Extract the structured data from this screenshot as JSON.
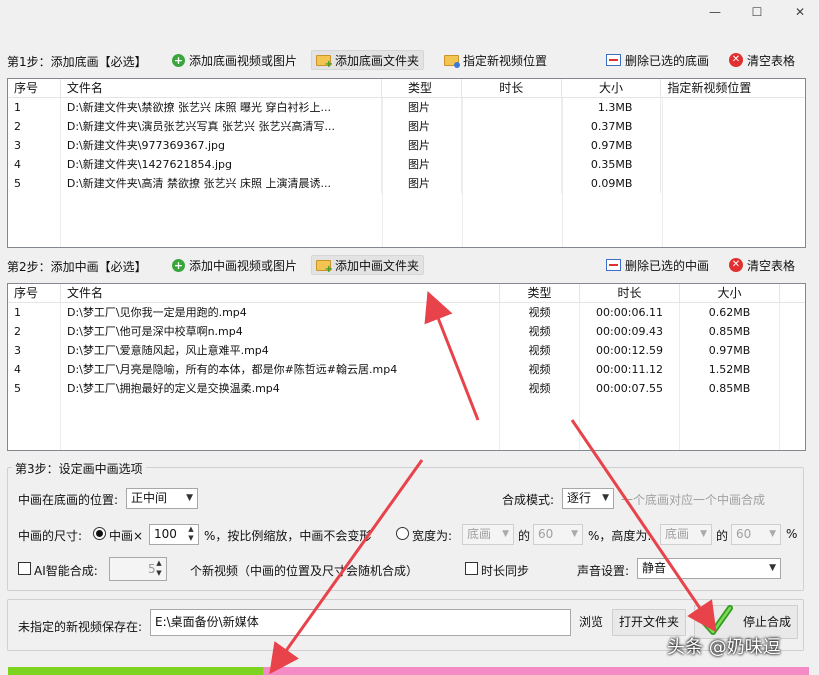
{
  "window": {
    "minimize": "—",
    "maximize": "☐",
    "close": "✕"
  },
  "step1": {
    "label": "第1步：添加底画【必选】",
    "toolbar": {
      "add_media": "添加底画视频或图片",
      "add_folder": "添加底画文件夹",
      "set_location": "指定新视频位置",
      "delete_selected": "删除已选的底画",
      "clear": "清空表格"
    },
    "columns": [
      "序号",
      "文件名",
      "类型",
      "时长",
      "大小",
      "指定新视频位置"
    ],
    "rows": [
      {
        "index": "1",
        "name": "D:\\新建文件夹\\禁欲撩 张艺兴 床照 曝光 穿白衬衫上...",
        "type": "图片",
        "duration": "",
        "size": "1.3MB",
        "location": ""
      },
      {
        "index": "2",
        "name": "D:\\新建文件夹\\演员张艺兴写真 张艺兴 张艺兴高清写...",
        "type": "图片",
        "duration": "",
        "size": "0.37MB",
        "location": ""
      },
      {
        "index": "3",
        "name": "D:\\新建文件夹\\977369367.jpg",
        "type": "图片",
        "duration": "",
        "size": "0.97MB",
        "location": ""
      },
      {
        "index": "4",
        "name": "D:\\新建文件夹\\1427621854.jpg",
        "type": "图片",
        "duration": "",
        "size": "0.35MB",
        "location": ""
      },
      {
        "index": "5",
        "name": "D:\\新建文件夹\\高清 禁欲撩 张艺兴 床照 上演清晨诱...",
        "type": "图片",
        "duration": "",
        "size": "0.09MB",
        "location": ""
      }
    ]
  },
  "step2": {
    "label": "第2步：添加中画【必选】",
    "toolbar": {
      "add_media": "添加中画视频或图片",
      "add_folder": "添加中画文件夹",
      "delete_selected": "删除已选的中画",
      "clear": "清空表格"
    },
    "columns": [
      "序号",
      "文件名",
      "类型",
      "时长",
      "大小"
    ],
    "rows": [
      {
        "index": "1",
        "name": "D:\\梦工厂\\见你我一定是用跑的.mp4",
        "type": "视频",
        "duration": "00:00:06.11",
        "size": "0.62MB"
      },
      {
        "index": "2",
        "name": "D:\\梦工厂\\他可是深中校草啊n.mp4",
        "type": "视频",
        "duration": "00:00:09.43",
        "size": "0.85MB"
      },
      {
        "index": "3",
        "name": "D:\\梦工厂\\爱意随风起，风止意难平.mp4",
        "type": "视频",
        "duration": "00:00:12.59",
        "size": "0.97MB"
      },
      {
        "index": "4",
        "name": "D:\\梦工厂\\月亮是隐喻，所有的本体，都是你#陈哲远#翰云居.mp4",
        "type": "视频",
        "duration": "00:00:11.12",
        "size": "1.52MB"
      },
      {
        "index": "5",
        "name": "D:\\梦工厂\\拥抱最好的定义是交换温柔.mp4",
        "type": "视频",
        "duration": "00:00:07.55",
        "size": "0.85MB"
      }
    ]
  },
  "step3": {
    "label": "第3步：设定画中画选项",
    "position_label": "中画在底画的位置:",
    "position_value": "正中间",
    "mode_label": "合成模式:",
    "mode_value": "逐行",
    "mode_desc": "一个底画对应一个中画合成",
    "size_label": "中画的尺寸:",
    "size_radio1_label": "中画×",
    "size_scale_value": "100",
    "size_scale_suffix": "%，按比例缩放，中画不会变形",
    "size_radio2_label": "宽度为:",
    "width_select": "底画",
    "of1": "的",
    "width_pct": "60",
    "height_label": "%，高度为:",
    "height_select": "底画",
    "of2": "的",
    "height_pct": "60",
    "pct": "%",
    "ai_label": "AI智能合成:",
    "ai_count": "5",
    "ai_desc": "个新视频（中画的位置及尺寸会随机合成）",
    "sync_label": "时长同步",
    "sound_label": "声音设置:",
    "sound_value": "静音"
  },
  "save": {
    "label": "未指定的新视频保存在:",
    "path": "E:\\桌面备份\\新媒体",
    "browse": "浏览",
    "open_folder": "打开文件夹",
    "stop": "停止合成"
  },
  "watermark": "头条 @奶味逗",
  "colors": {
    "progress_done": "#7ed321",
    "progress_rest": "#f58bc4",
    "arrow": "#e8434a",
    "accent": "#3aa53a"
  }
}
